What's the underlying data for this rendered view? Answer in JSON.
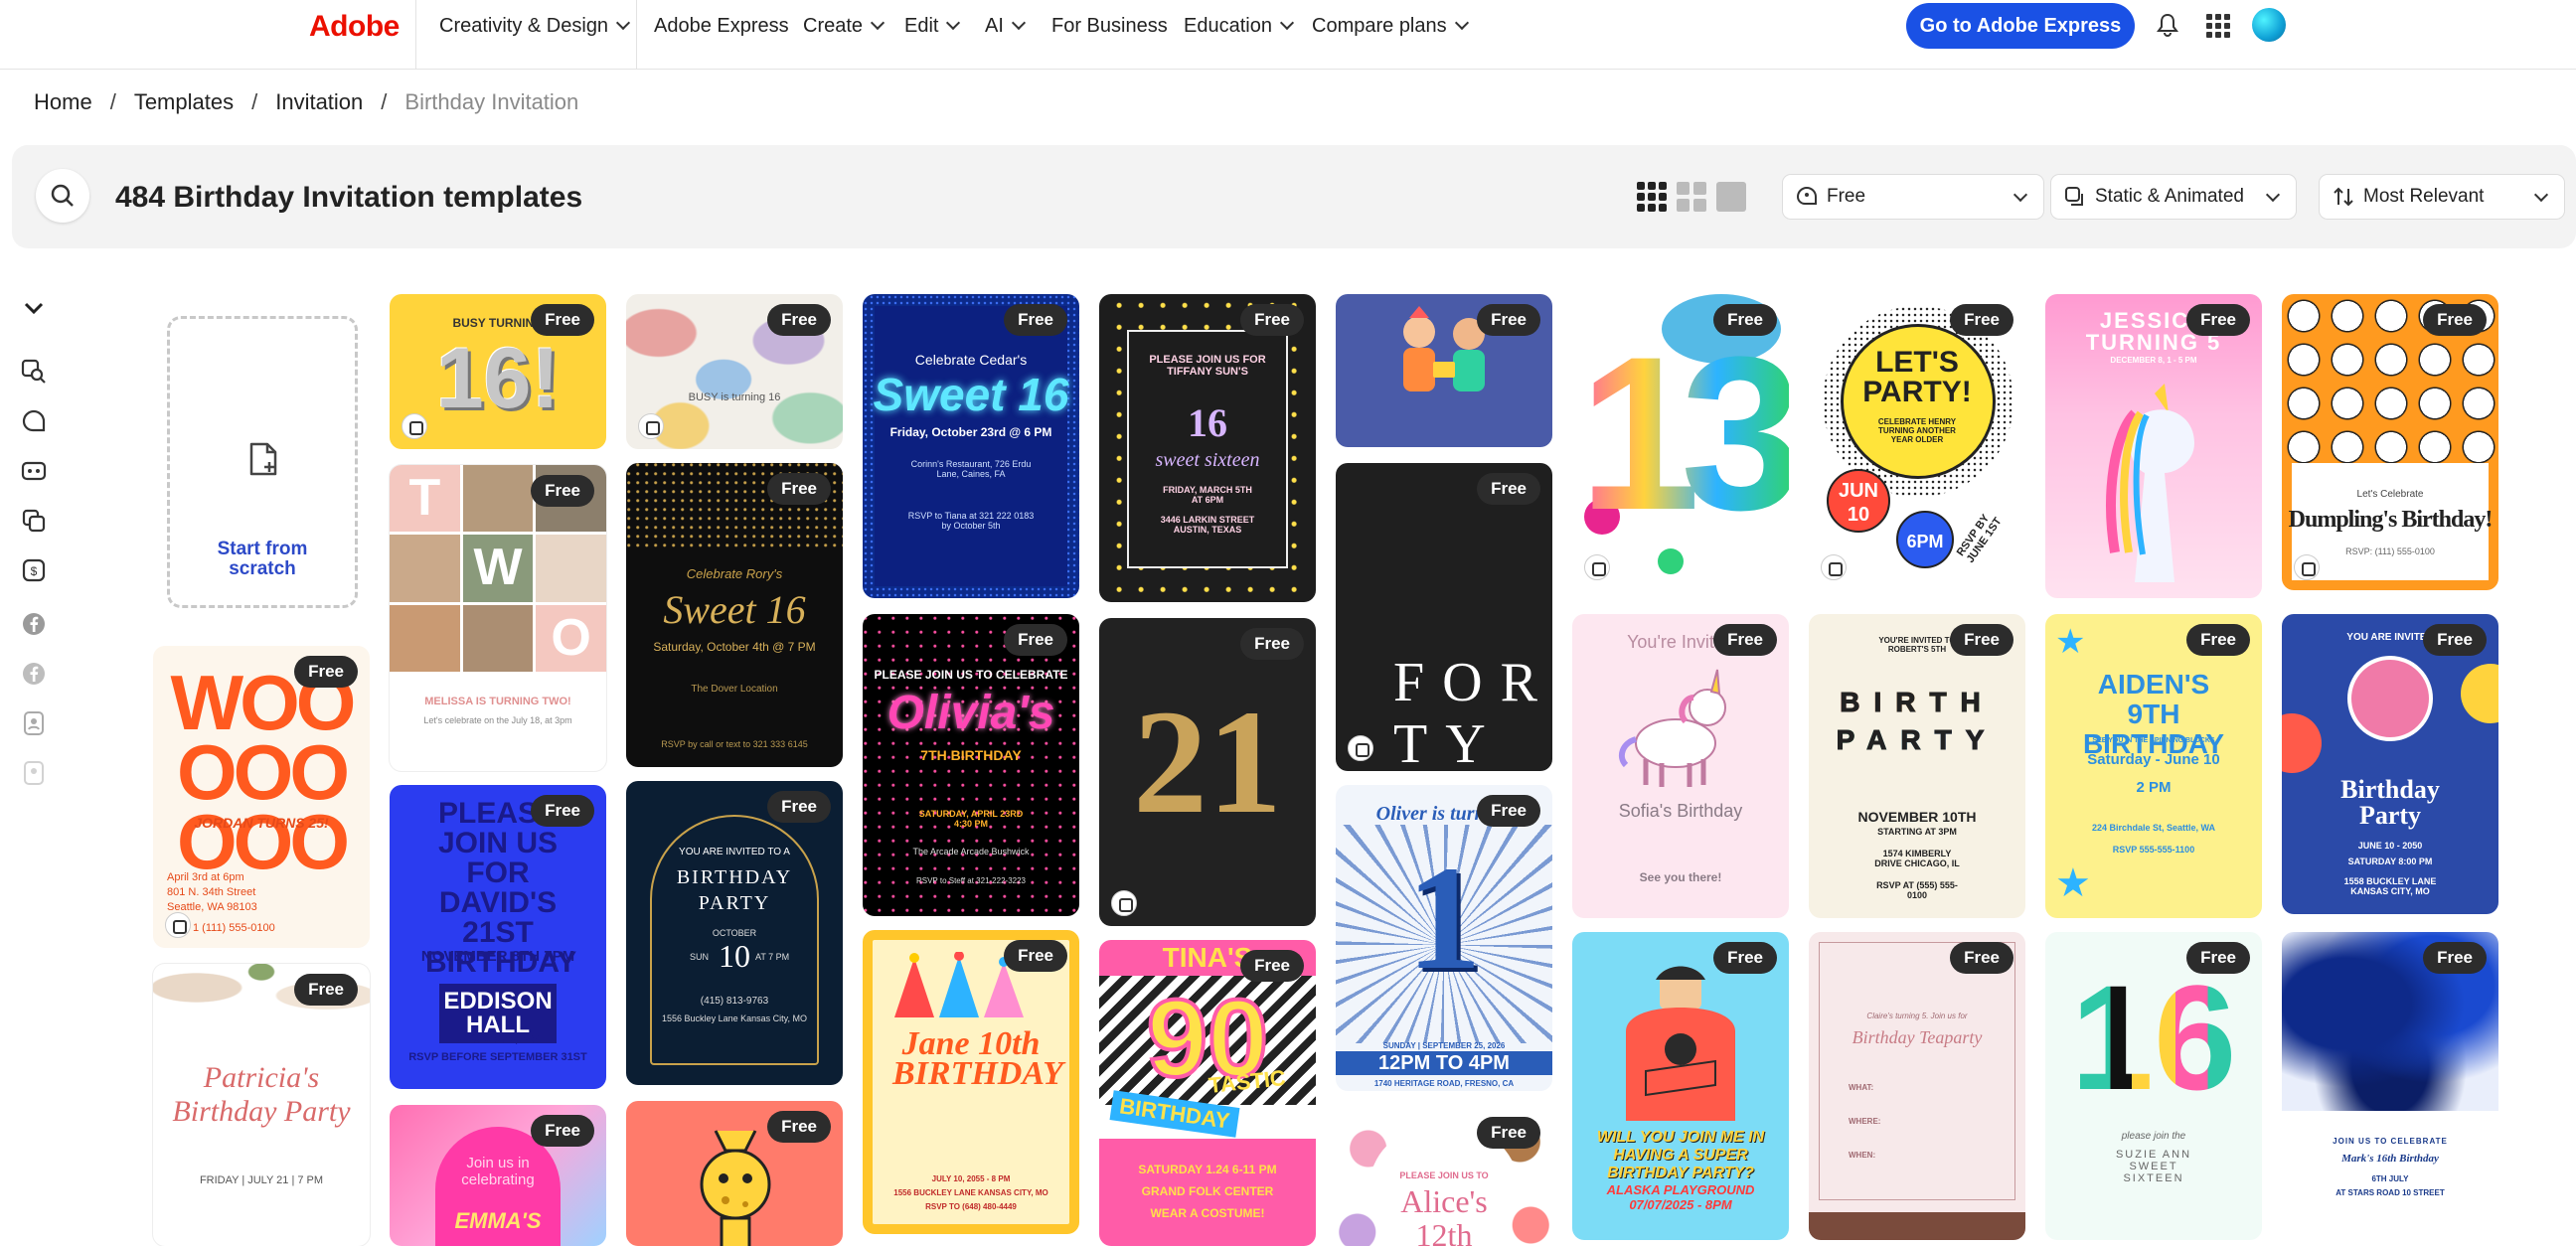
{
  "nav": {
    "logo": "Adobe",
    "items": [
      "Creativity & Design",
      "Adobe Express",
      "Create",
      "Edit",
      "AI",
      "For Business",
      "Education",
      "Compare plans"
    ],
    "cta": "Go to Adobe Express"
  },
  "breadcrumb": [
    "Home",
    "Templates",
    "Invitation",
    "Birthday Invitation"
  ],
  "toolbar": {
    "count_title": "484 Birthday Invitation templates",
    "filter_price": "Free",
    "filter_type": "Static & Animated",
    "sort": "Most Relevant"
  },
  "scratch": {
    "label_line1": "Start from",
    "label_line2": "scratch"
  },
  "badge": "Free",
  "cards": {
    "c1": {
      "big": "16!",
      "small": "BUSY TURNING"
    },
    "c2": {
      "small": "BUSY is turning 16"
    },
    "c3": {
      "top": "Celebrate Cedar's",
      "title": "Sweet 16",
      "date": "Friday, October 23rd @ 6 PM",
      "place": "Corinn's Restaurant, 726 Erdu Lane, Caines, FA",
      "rsvp": "RSVP to Tiana at 321 222 0183 by October 5th"
    },
    "c4": {
      "top": "PLEASE JOIN US FOR TIFFANY SUN'S",
      "num": "16",
      "title": "sweet sixteen",
      "date": "FRIDAY, MARCH 5TH AT 6PM",
      "place": "3446 LARKIN STREET AUSTIN, TEXAS"
    },
    "c6": {
      "big": "13"
    },
    "c7": {
      "title": "LET'S PARTY!",
      "sub": "CELEBRATE HENRY TURNING ANOTHER YEAR OLDER",
      "date": "JUN 10",
      "time": "6PM",
      "rsvp": "RSVP BY JUNE 1ST"
    },
    "c8": {
      "title": "JESSICA TURNING 5",
      "date": "DECEMBER 8, 1 - 5 PM"
    },
    "c9": {
      "top": "Let's Celebrate",
      "title": "Dumpling's Birthday!",
      "rsvp": "RSVP: (111) 555-0100"
    },
    "c10": {
      "l1": "T",
      "l2": "W",
      "l3": "O",
      "name": "MELISSA IS TURNING TWO!",
      "info": "Let's celebrate on the July 18, at 3pm"
    },
    "c11": {
      "top": "Celebrate Rory's",
      "title": "Sweet 16",
      "date": "Saturday, October 4th @ 7 PM",
      "place": "The Dover Location",
      "rsvp": "RSVP by call or text to 321 333 6145"
    },
    "c12": {
      "top": "PLEASE JOIN US TO CELEBRATE",
      "title": "Olivia's",
      "sub": "7TH BIRTHDAY",
      "date": "SATURDAY, APRIL 23RD 4:30 PM",
      "place": "The Arcade Arcade Bushwick",
      "rsvp": "RSVP to Steff at 321-222-3223"
    },
    "c13": {
      "big": "21"
    },
    "c14": {
      "title": "FORTY"
    },
    "c15": {
      "top": "You're Invited",
      "name": "Sofia's Birthday",
      "foot": "See you there!"
    },
    "c16": {
      "top": "YOU'RE INVITED TO ROBERT'S 5TH",
      "title": "BIRTH PARTY",
      "date": "NOVEMBER 10TH",
      "time": "STARTING AT 3PM",
      "place": "1574 KIMBERLY DRIVE CHICAGO, IL",
      "rsvp": "RSVP AT (555) 555-0100"
    },
    "c17": {
      "title": "AIDEN'S 9TH BIRTHDAY",
      "sub": "SEE YOU IN THE SPINNING BLOCKS",
      "date": "Saturday - June 10",
      "time": "2 PM",
      "place": "224 Birchdale St, Seattle, WA",
      "rsvp": "RSVP 555-555-1100"
    },
    "c18": {
      "top": "YOU ARE INVITED",
      "title": "Birthday Party",
      "date": "JUNE 10 - 2050",
      "time": "SATURDAY 8:00 PM",
      "place": "1558 BUCKLEY LANE KANSAS CITY, MO"
    },
    "c19": {
      "big": "WOOOOOOOO",
      "name": "JORDAN TURNS 25!",
      "date": "April 3rd at 6pm",
      "place": "801 N. 34th Street Seattle, WA 98103",
      "rsvp": "1 (111) 555-0100"
    },
    "c20": {
      "title": "PLEASE JOIN US FOR DAVID'S 21ST BIRTHDAY",
      "month": "NOVEMBER 8TH 7PM",
      "place": "EDDISON HALL",
      "city": "JACKSON, MS",
      "rsvp": "RSVP BEFORE SEPTEMBER 31ST"
    },
    "c21": {
      "top": "YOU ARE INVITED TO A",
      "title": "BIRTHDAY PARTY",
      "month": "OCTOBER",
      "day": "10",
      "dow": "SUN",
      "time": "AT 7 PM",
      "phone": "(415) 813-9763",
      "place": "1556 Buckley Lane Kansas City, MO"
    },
    "c22": {
      "title": "Oliver is turning",
      "big": "1",
      "date": "SUNDAY | SEPTEMBER 25, 2026",
      "time": "12PM TO 4PM",
      "place": "1740 HERITAGE ROAD, FRESNO, CA"
    },
    "c23": {
      "title": "Jane 10th BIRTHDAY",
      "date": "JULY 10, 2055 - 8 PM",
      "place": "1556 BUCKLEY LANE KANSAS CITY, MO",
      "rsvp": "RSVP TO (648) 480-4449"
    },
    "c24": {
      "top": "TINA'S",
      "big": "90",
      "sub": "TASTIC",
      "title": "BIRTHDAY",
      "date": "SATURDAY 1.24 6-11 PM",
      "place": "GRAND FOLK CENTER",
      "foot": "WEAR A COSTUME!"
    },
    "c25": {
      "title": "WILL YOU JOIN ME IN HAVING A SUPER BIRTHDAY PARTY?",
      "date": "ALASKA PLAYGROUND 07/07/2025 - 8PM"
    },
    "c26": {
      "top": "Claire's turning 5. Join us for",
      "title": "Birthday Teaparty",
      "rows": "WHAT: WHERE: WHEN:"
    },
    "c27": {
      "big": "16",
      "top": "please join the",
      "title": "SUZIE ANN SWEET SIXTEEN"
    },
    "c28": {
      "top": "JOIN US TO CELEBRATE",
      "title": "Mark's 16th Birthday",
      "date": "6TH JULY",
      "place": "AT STARS ROAD 10 STREET"
    },
    "c29": {
      "title": "Patricia's Birthday Party",
      "date": "FRIDAY | JULY 21 | 7 PM"
    },
    "c30": {
      "top": "Join us in celebrating",
      "name": "EMMA'S"
    },
    "c32": {
      "top": "PLEASE JOIN US TO",
      "name": "Alice's 12th"
    }
  }
}
